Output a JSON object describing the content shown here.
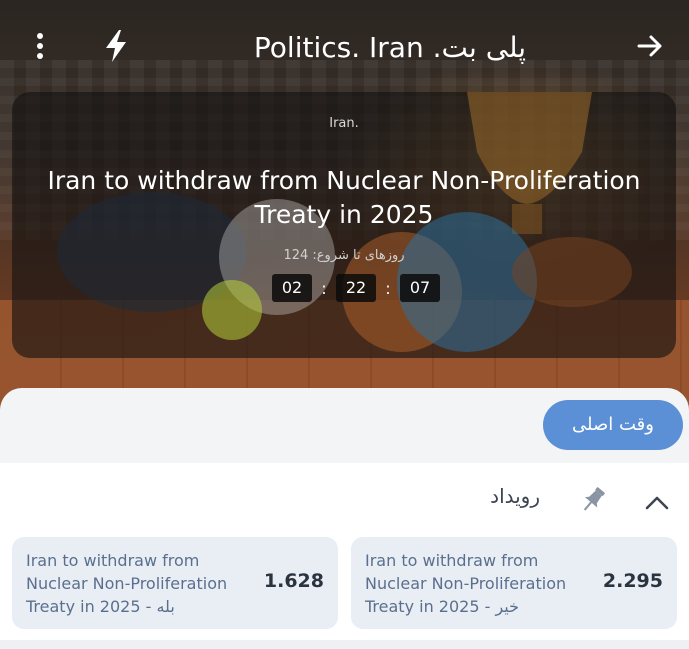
{
  "header": {
    "title": "Politics. Iran .پلی بت",
    "menu_icon": "more-vertical-icon",
    "bolt_icon": "lightning-bolt-icon",
    "forward_icon": "arrow-right-icon"
  },
  "event": {
    "category": "Iran.",
    "title": "Iran to withdraw from Nuclear Non-Proliferation Treaty in 2025",
    "days_to_start": "روزهای تا شروع: 124",
    "timer": {
      "hours": "02",
      "minutes": "22",
      "seconds": "07",
      "separator": ":"
    }
  },
  "main_time_button": "وقت اصلی",
  "market": {
    "title": "رویداد",
    "outcomes": [
      {
        "name": "Iran to withdraw from Nuclear Non-Proliferation Treaty in 2025 - بله",
        "odds": "1.628"
      },
      {
        "name": "Iran to withdraw from Nuclear Non-Proliferation Treaty in 2025 - خیر",
        "odds": "2.295"
      }
    ]
  },
  "colors": {
    "accent_button": "#5b8fd6",
    "outcome_bg": "#e9eef4",
    "outcome_text": "#5a6f8e",
    "odds_text": "#2a3340"
  }
}
